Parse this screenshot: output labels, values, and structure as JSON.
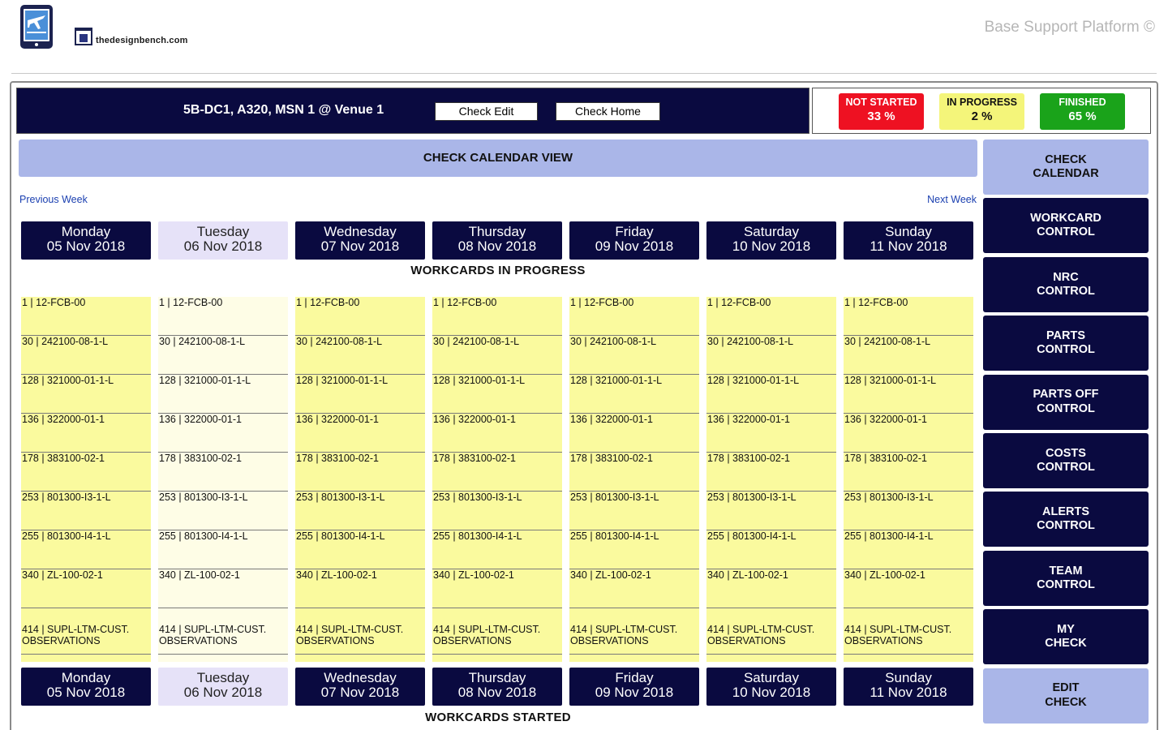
{
  "header": {
    "brand": "thedesignbench.com",
    "platform_title": "Base Support Platform ©"
  },
  "aircraft": {
    "label": "5B-DC1, A320, MSN 1 @ Venue 1",
    "check_edit": "Check Edit",
    "check_home": "Check Home"
  },
  "status": {
    "not_started": {
      "label": "NOT STARTED",
      "value": "33 %",
      "color": "#ee1122"
    },
    "in_progress": {
      "label": "IN PROGRESS",
      "value": "2 %",
      "color": "#f4f57a"
    },
    "finished": {
      "label": "FINISHED",
      "value": "65 %",
      "color": "#1aa31a"
    }
  },
  "calendar": {
    "title": "CHECK CALENDAR VIEW",
    "prev_week": "Previous Week",
    "next_week": "Next Week",
    "section_in_progress": "WORKCARDS IN PROGRESS",
    "section_started": "WORKCARDS STARTED",
    "days": [
      {
        "day": "Monday",
        "date": "05 Nov 2018"
      },
      {
        "day": "Tuesday",
        "date": "06 Nov 2018",
        "today": true
      },
      {
        "day": "Wednesday",
        "date": "07 Nov 2018"
      },
      {
        "day": "Thursday",
        "date": "08 Nov 2018"
      },
      {
        "day": "Friday",
        "date": "09 Nov 2018"
      },
      {
        "day": "Saturday",
        "date": "10 Nov 2018"
      },
      {
        "day": "Sunday",
        "date": "11 Nov 2018"
      }
    ],
    "workcards": [
      "1 | 12-FCB-00",
      "30 | 242100-08-1-L",
      "128 | 321000-01-1-L",
      "136 | 322000-01-1",
      "178 | 383100-02-1",
      "253 | 801300-I3-1-L",
      "255 | 801300-I4-1-L",
      "340 | ZL-100-02-1",
      "414 | SUPL-LTM-CUST. OBSERVATIONS"
    ]
  },
  "menu": [
    {
      "label": "CHECK\nCALENDAR",
      "style": "light"
    },
    {
      "label": "WORKCARD\nCONTROL",
      "style": "dark"
    },
    {
      "label": "NRC\nCONTROL",
      "style": "dark"
    },
    {
      "label": "PARTS\nCONTROL",
      "style": "dark"
    },
    {
      "label": "PARTS OFF\nCONTROL",
      "style": "dark"
    },
    {
      "label": "COSTS\nCONTROL",
      "style": "dark"
    },
    {
      "label": "ALERTS\nCONTROL",
      "style": "dark"
    },
    {
      "label": "TEAM\nCONTROL",
      "style": "dark"
    },
    {
      "label": "MY\nCHECK",
      "style": "dark"
    },
    {
      "label": "EDIT\nCHECK",
      "style": "light"
    }
  ]
}
